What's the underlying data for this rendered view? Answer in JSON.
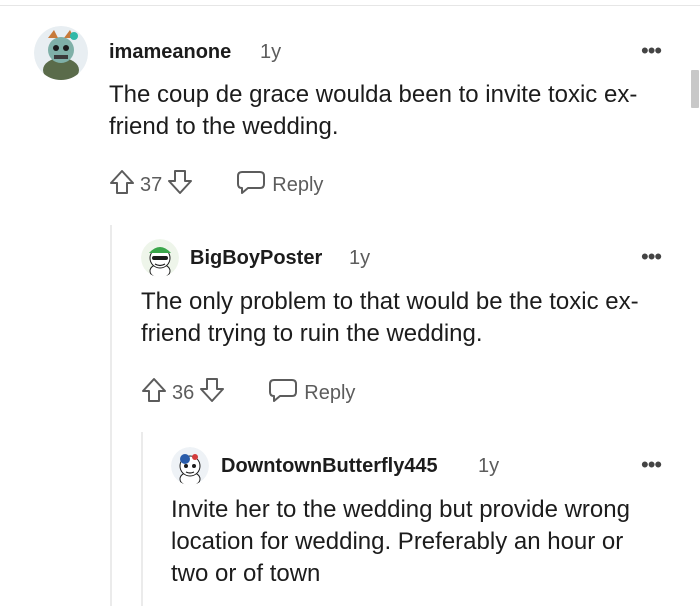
{
  "comments": [
    {
      "username": "imameanone",
      "time": "1y",
      "body": "The coup de grace woulda been to invite toxic ex-friend to the wedding.",
      "votes": "37",
      "reply_label": "Reply",
      "more_icon": "more-options-icon"
    },
    {
      "username": "BigBoyPoster",
      "time": "1y",
      "body": "The only problem to that would be the toxic ex-friend trying to ruin the wedding.",
      "votes": "36",
      "reply_label": "Reply",
      "more_icon": "more-options-icon"
    },
    {
      "username": "DowntownButterfly445",
      "time": "1y",
      "body": "Invite her to the wedding but provide wrong location for wedding. Preferably an hour or two or of town",
      "more_icon": "more-options-icon"
    }
  ],
  "colors": {
    "text": "#1c1c1c",
    "muted": "#5c5c5c",
    "thread_line": "#ebebeb"
  }
}
